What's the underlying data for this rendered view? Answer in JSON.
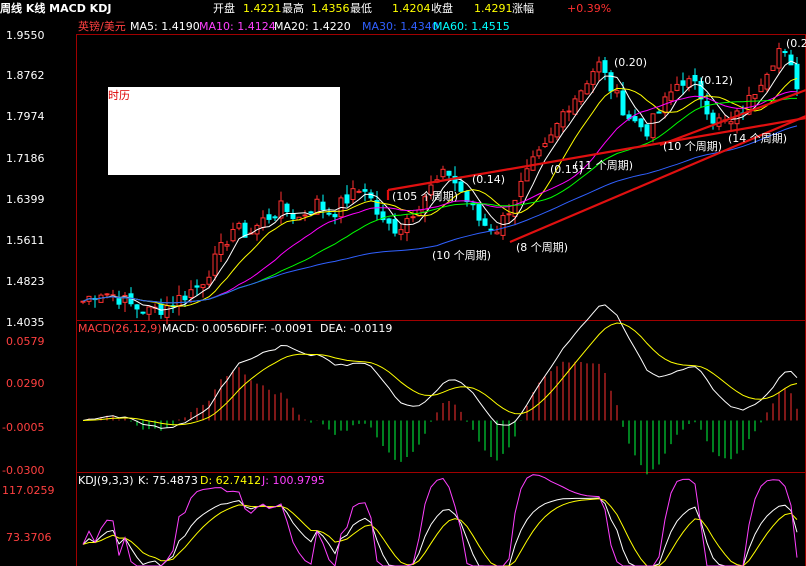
{
  "header": {
    "title": "周线 K线 MACD KDJ",
    "open_label": "开盘",
    "open_value": "1.4221",
    "high_label": "最高",
    "high_value": "1.4356",
    "low_label": "最低",
    "low_value": "1.4204",
    "close_label": "收盘",
    "close_value": "1.4291",
    "change_label": "涨幅",
    "change_value": "+0.39%"
  },
  "price_panel": {
    "symbol": "英镑/美元",
    "ma5": "MA5: 1.4190",
    "ma10": "MA10: 1.4124",
    "ma20": "MA20: 1.4220",
    "ma30": "MA30: 1.4340",
    "ma60": "MA60: 1.4515",
    "y_ticks": [
      "1.9550",
      "1.8762",
      "1.7974",
      "1.7186",
      "1.6399",
      "1.5611",
      "1.4823",
      "1.4035"
    ],
    "note_text": "时历",
    "annotations": [
      "(0.20)",
      "(0.12)",
      "(0.14)",
      "(0.15)",
      "(105 个周期)",
      "(10 个周期)",
      "(8 个周期)",
      "(11 个周期)",
      "(10 个周期)",
      "(14 个周期)",
      "(0.2"
    ]
  },
  "macd_panel": {
    "title": "MACD(26,12,9)",
    "macd": "MACD: 0.0056",
    "diff": "DIFF: -0.0091",
    "dea": "DEA: -0.0119",
    "y_ticks": [
      "0.0579",
      "0.0290",
      "-0.0005",
      "-0.0300"
    ]
  },
  "kdj_panel": {
    "title": "KDJ(9,3,3)",
    "k": "K: 75.4873",
    "d": "D: 62.7412",
    "j": "J: 100.9795",
    "y_ticks": [
      "117.0259",
      "73.3706"
    ]
  },
  "colors": {
    "up": "#ff3030",
    "down": "#00ffff",
    "ma5": "#ffffff",
    "ma10": "#ffff00",
    "ma20": "#ff00ff",
    "ma30": "#00ff00",
    "ma60": "#3060ff",
    "frame": "#a00000"
  },
  "chart_data": {
    "type": "candlestick",
    "x_label": "",
    "y_label": "",
    "ylim_price": [
      1.4035,
      1.955
    ],
    "ylim_macd": [
      -0.03,
      0.0579
    ],
    "ylim_kdj": [
      29.7,
      117.0259
    ],
    "price_anchors": [
      1.44,
      1.46,
      1.45,
      1.43,
      1.42,
      1.43,
      1.45,
      1.47,
      1.52,
      1.58,
      1.57,
      1.6,
      1.62,
      1.6,
      1.63,
      1.61,
      1.64,
      1.66,
      1.59,
      1.58,
      1.62,
      1.66,
      1.69,
      1.64,
      1.59,
      1.58,
      1.64,
      1.7,
      1.74,
      1.81,
      1.85,
      1.9,
      1.84,
      1.79,
      1.77,
      1.82,
      1.87,
      1.85,
      1.79,
      1.78,
      1.82,
      1.88,
      1.93,
      1.86
    ]
  }
}
